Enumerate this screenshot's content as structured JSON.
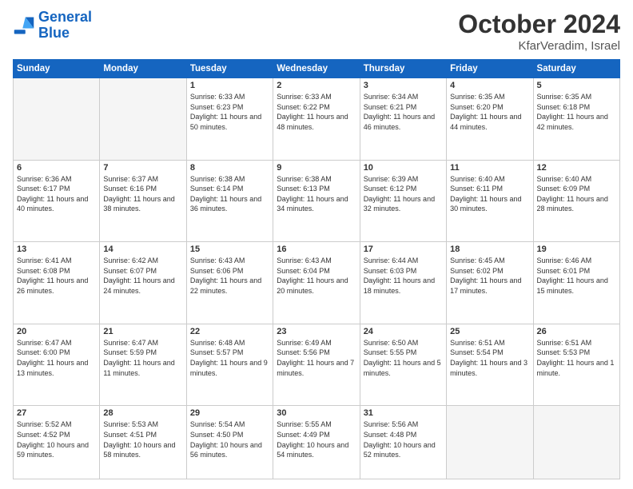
{
  "header": {
    "logo_line1": "General",
    "logo_line2": "Blue",
    "month_title": "October 2024",
    "location": "KfarVeradim, Israel"
  },
  "weekdays": [
    "Sunday",
    "Monday",
    "Tuesday",
    "Wednesday",
    "Thursday",
    "Friday",
    "Saturday"
  ],
  "rows": [
    [
      {
        "day": "",
        "text": ""
      },
      {
        "day": "",
        "text": ""
      },
      {
        "day": "1",
        "text": "Sunrise: 6:33 AM\nSunset: 6:23 PM\nDaylight: 11 hours and 50 minutes."
      },
      {
        "day": "2",
        "text": "Sunrise: 6:33 AM\nSunset: 6:22 PM\nDaylight: 11 hours and 48 minutes."
      },
      {
        "day": "3",
        "text": "Sunrise: 6:34 AM\nSunset: 6:21 PM\nDaylight: 11 hours and 46 minutes."
      },
      {
        "day": "4",
        "text": "Sunrise: 6:35 AM\nSunset: 6:20 PM\nDaylight: 11 hours and 44 minutes."
      },
      {
        "day": "5",
        "text": "Sunrise: 6:35 AM\nSunset: 6:18 PM\nDaylight: 11 hours and 42 minutes."
      }
    ],
    [
      {
        "day": "6",
        "text": "Sunrise: 6:36 AM\nSunset: 6:17 PM\nDaylight: 11 hours and 40 minutes."
      },
      {
        "day": "7",
        "text": "Sunrise: 6:37 AM\nSunset: 6:16 PM\nDaylight: 11 hours and 38 minutes."
      },
      {
        "day": "8",
        "text": "Sunrise: 6:38 AM\nSunset: 6:14 PM\nDaylight: 11 hours and 36 minutes."
      },
      {
        "day": "9",
        "text": "Sunrise: 6:38 AM\nSunset: 6:13 PM\nDaylight: 11 hours and 34 minutes."
      },
      {
        "day": "10",
        "text": "Sunrise: 6:39 AM\nSunset: 6:12 PM\nDaylight: 11 hours and 32 minutes."
      },
      {
        "day": "11",
        "text": "Sunrise: 6:40 AM\nSunset: 6:11 PM\nDaylight: 11 hours and 30 minutes."
      },
      {
        "day": "12",
        "text": "Sunrise: 6:40 AM\nSunset: 6:09 PM\nDaylight: 11 hours and 28 minutes."
      }
    ],
    [
      {
        "day": "13",
        "text": "Sunrise: 6:41 AM\nSunset: 6:08 PM\nDaylight: 11 hours and 26 minutes."
      },
      {
        "day": "14",
        "text": "Sunrise: 6:42 AM\nSunset: 6:07 PM\nDaylight: 11 hours and 24 minutes."
      },
      {
        "day": "15",
        "text": "Sunrise: 6:43 AM\nSunset: 6:06 PM\nDaylight: 11 hours and 22 minutes."
      },
      {
        "day": "16",
        "text": "Sunrise: 6:43 AM\nSunset: 6:04 PM\nDaylight: 11 hours and 20 minutes."
      },
      {
        "day": "17",
        "text": "Sunrise: 6:44 AM\nSunset: 6:03 PM\nDaylight: 11 hours and 18 minutes."
      },
      {
        "day": "18",
        "text": "Sunrise: 6:45 AM\nSunset: 6:02 PM\nDaylight: 11 hours and 17 minutes."
      },
      {
        "day": "19",
        "text": "Sunrise: 6:46 AM\nSunset: 6:01 PM\nDaylight: 11 hours and 15 minutes."
      }
    ],
    [
      {
        "day": "20",
        "text": "Sunrise: 6:47 AM\nSunset: 6:00 PM\nDaylight: 11 hours and 13 minutes."
      },
      {
        "day": "21",
        "text": "Sunrise: 6:47 AM\nSunset: 5:59 PM\nDaylight: 11 hours and 11 minutes."
      },
      {
        "day": "22",
        "text": "Sunrise: 6:48 AM\nSunset: 5:57 PM\nDaylight: 11 hours and 9 minutes."
      },
      {
        "day": "23",
        "text": "Sunrise: 6:49 AM\nSunset: 5:56 PM\nDaylight: 11 hours and 7 minutes."
      },
      {
        "day": "24",
        "text": "Sunrise: 6:50 AM\nSunset: 5:55 PM\nDaylight: 11 hours and 5 minutes."
      },
      {
        "day": "25",
        "text": "Sunrise: 6:51 AM\nSunset: 5:54 PM\nDaylight: 11 hours and 3 minutes."
      },
      {
        "day": "26",
        "text": "Sunrise: 6:51 AM\nSunset: 5:53 PM\nDaylight: 11 hours and 1 minute."
      }
    ],
    [
      {
        "day": "27",
        "text": "Sunrise: 5:52 AM\nSunset: 4:52 PM\nDaylight: 10 hours and 59 minutes."
      },
      {
        "day": "28",
        "text": "Sunrise: 5:53 AM\nSunset: 4:51 PM\nDaylight: 10 hours and 58 minutes."
      },
      {
        "day": "29",
        "text": "Sunrise: 5:54 AM\nSunset: 4:50 PM\nDaylight: 10 hours and 56 minutes."
      },
      {
        "day": "30",
        "text": "Sunrise: 5:55 AM\nSunset: 4:49 PM\nDaylight: 10 hours and 54 minutes."
      },
      {
        "day": "31",
        "text": "Sunrise: 5:56 AM\nSunset: 4:48 PM\nDaylight: 10 hours and 52 minutes."
      },
      {
        "day": "",
        "text": ""
      },
      {
        "day": "",
        "text": ""
      }
    ]
  ]
}
